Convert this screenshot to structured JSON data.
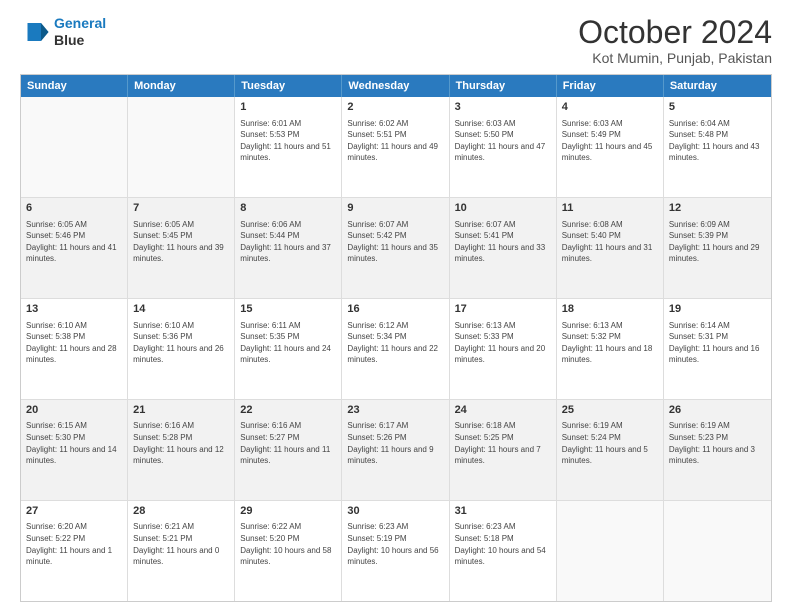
{
  "logo": {
    "line1": "General",
    "line2": "Blue"
  },
  "title": "October 2024",
  "subtitle": "Kot Mumin, Punjab, Pakistan",
  "header_days": [
    "Sunday",
    "Monday",
    "Tuesday",
    "Wednesday",
    "Thursday",
    "Friday",
    "Saturday"
  ],
  "weeks": [
    [
      {
        "day": "",
        "sunrise": "",
        "sunset": "",
        "daylight": ""
      },
      {
        "day": "",
        "sunrise": "",
        "sunset": "",
        "daylight": ""
      },
      {
        "day": "1",
        "sunrise": "Sunrise: 6:01 AM",
        "sunset": "Sunset: 5:53 PM",
        "daylight": "Daylight: 11 hours and 51 minutes."
      },
      {
        "day": "2",
        "sunrise": "Sunrise: 6:02 AM",
        "sunset": "Sunset: 5:51 PM",
        "daylight": "Daylight: 11 hours and 49 minutes."
      },
      {
        "day": "3",
        "sunrise": "Sunrise: 6:03 AM",
        "sunset": "Sunset: 5:50 PM",
        "daylight": "Daylight: 11 hours and 47 minutes."
      },
      {
        "day": "4",
        "sunrise": "Sunrise: 6:03 AM",
        "sunset": "Sunset: 5:49 PM",
        "daylight": "Daylight: 11 hours and 45 minutes."
      },
      {
        "day": "5",
        "sunrise": "Sunrise: 6:04 AM",
        "sunset": "Sunset: 5:48 PM",
        "daylight": "Daylight: 11 hours and 43 minutes."
      }
    ],
    [
      {
        "day": "6",
        "sunrise": "Sunrise: 6:05 AM",
        "sunset": "Sunset: 5:46 PM",
        "daylight": "Daylight: 11 hours and 41 minutes."
      },
      {
        "day": "7",
        "sunrise": "Sunrise: 6:05 AM",
        "sunset": "Sunset: 5:45 PM",
        "daylight": "Daylight: 11 hours and 39 minutes."
      },
      {
        "day": "8",
        "sunrise": "Sunrise: 6:06 AM",
        "sunset": "Sunset: 5:44 PM",
        "daylight": "Daylight: 11 hours and 37 minutes."
      },
      {
        "day": "9",
        "sunrise": "Sunrise: 6:07 AM",
        "sunset": "Sunset: 5:42 PM",
        "daylight": "Daylight: 11 hours and 35 minutes."
      },
      {
        "day": "10",
        "sunrise": "Sunrise: 6:07 AM",
        "sunset": "Sunset: 5:41 PM",
        "daylight": "Daylight: 11 hours and 33 minutes."
      },
      {
        "day": "11",
        "sunrise": "Sunrise: 6:08 AM",
        "sunset": "Sunset: 5:40 PM",
        "daylight": "Daylight: 11 hours and 31 minutes."
      },
      {
        "day": "12",
        "sunrise": "Sunrise: 6:09 AM",
        "sunset": "Sunset: 5:39 PM",
        "daylight": "Daylight: 11 hours and 29 minutes."
      }
    ],
    [
      {
        "day": "13",
        "sunrise": "Sunrise: 6:10 AM",
        "sunset": "Sunset: 5:38 PM",
        "daylight": "Daylight: 11 hours and 28 minutes."
      },
      {
        "day": "14",
        "sunrise": "Sunrise: 6:10 AM",
        "sunset": "Sunset: 5:36 PM",
        "daylight": "Daylight: 11 hours and 26 minutes."
      },
      {
        "day": "15",
        "sunrise": "Sunrise: 6:11 AM",
        "sunset": "Sunset: 5:35 PM",
        "daylight": "Daylight: 11 hours and 24 minutes."
      },
      {
        "day": "16",
        "sunrise": "Sunrise: 6:12 AM",
        "sunset": "Sunset: 5:34 PM",
        "daylight": "Daylight: 11 hours and 22 minutes."
      },
      {
        "day": "17",
        "sunrise": "Sunrise: 6:13 AM",
        "sunset": "Sunset: 5:33 PM",
        "daylight": "Daylight: 11 hours and 20 minutes."
      },
      {
        "day": "18",
        "sunrise": "Sunrise: 6:13 AM",
        "sunset": "Sunset: 5:32 PM",
        "daylight": "Daylight: 11 hours and 18 minutes."
      },
      {
        "day": "19",
        "sunrise": "Sunrise: 6:14 AM",
        "sunset": "Sunset: 5:31 PM",
        "daylight": "Daylight: 11 hours and 16 minutes."
      }
    ],
    [
      {
        "day": "20",
        "sunrise": "Sunrise: 6:15 AM",
        "sunset": "Sunset: 5:30 PM",
        "daylight": "Daylight: 11 hours and 14 minutes."
      },
      {
        "day": "21",
        "sunrise": "Sunrise: 6:16 AM",
        "sunset": "Sunset: 5:28 PM",
        "daylight": "Daylight: 11 hours and 12 minutes."
      },
      {
        "day": "22",
        "sunrise": "Sunrise: 6:16 AM",
        "sunset": "Sunset: 5:27 PM",
        "daylight": "Daylight: 11 hours and 11 minutes."
      },
      {
        "day": "23",
        "sunrise": "Sunrise: 6:17 AM",
        "sunset": "Sunset: 5:26 PM",
        "daylight": "Daylight: 11 hours and 9 minutes."
      },
      {
        "day": "24",
        "sunrise": "Sunrise: 6:18 AM",
        "sunset": "Sunset: 5:25 PM",
        "daylight": "Daylight: 11 hours and 7 minutes."
      },
      {
        "day": "25",
        "sunrise": "Sunrise: 6:19 AM",
        "sunset": "Sunset: 5:24 PM",
        "daylight": "Daylight: 11 hours and 5 minutes."
      },
      {
        "day": "26",
        "sunrise": "Sunrise: 6:19 AM",
        "sunset": "Sunset: 5:23 PM",
        "daylight": "Daylight: 11 hours and 3 minutes."
      }
    ],
    [
      {
        "day": "27",
        "sunrise": "Sunrise: 6:20 AM",
        "sunset": "Sunset: 5:22 PM",
        "daylight": "Daylight: 11 hours and 1 minute."
      },
      {
        "day": "28",
        "sunrise": "Sunrise: 6:21 AM",
        "sunset": "Sunset: 5:21 PM",
        "daylight": "Daylight: 11 hours and 0 minutes."
      },
      {
        "day": "29",
        "sunrise": "Sunrise: 6:22 AM",
        "sunset": "Sunset: 5:20 PM",
        "daylight": "Daylight: 10 hours and 58 minutes."
      },
      {
        "day": "30",
        "sunrise": "Sunrise: 6:23 AM",
        "sunset": "Sunset: 5:19 PM",
        "daylight": "Daylight: 10 hours and 56 minutes."
      },
      {
        "day": "31",
        "sunrise": "Sunrise: 6:23 AM",
        "sunset": "Sunset: 5:18 PM",
        "daylight": "Daylight: 10 hours and 54 minutes."
      },
      {
        "day": "",
        "sunrise": "",
        "sunset": "",
        "daylight": ""
      },
      {
        "day": "",
        "sunrise": "",
        "sunset": "",
        "daylight": ""
      }
    ]
  ]
}
